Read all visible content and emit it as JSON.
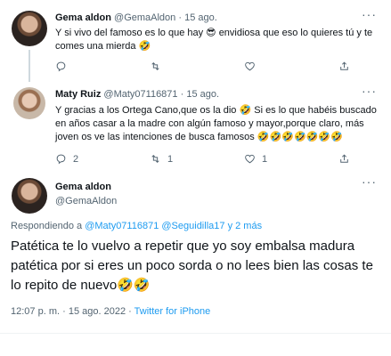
{
  "tweet1": {
    "name": "Gema aldon",
    "handle": "@GemaAldon",
    "sep": "·",
    "time": "15 ago.",
    "text_line1": "Y si vivo del famoso es lo que hay 😎 envidiosa que eso lo quieres tú y te",
    "text_line2": "comes una mierda 🤣",
    "reply_count": "",
    "retweet_count": "",
    "like_count": ""
  },
  "tweet2": {
    "name": "Maty Ruiz",
    "handle": "@Maty07116871",
    "sep": "·",
    "time": "15 ago.",
    "text_line1": "Y gracias a los Ortega Cano,que os la dio 🤣 Si es lo que habéis buscado",
    "text_line2": "en años casar a la madre con algún famoso y mayor,porque claro, más",
    "text_line3": "joven os ve las intenciones de busca famosos 🤣🤣🤣🤣🤣🤣🤣",
    "reply_count": "2",
    "retweet_count": "1",
    "like_count": "1"
  },
  "main_tweet": {
    "name": "Gema aldon",
    "handle": "@GemaAldon",
    "replying_prefix": "Respondiendo a",
    "replying_to_1": "@Maty07116871",
    "replying_to_2": "@Seguidilla17",
    "replying_suffix": "y 2 más",
    "text": "Patética te lo vuelvo a repetir que yo soy embalsa madura patética por si eres un poco sorda o no lees bien las cosas te lo repito de nuevo🤣🤣",
    "meta_time": "12:07 p. m.",
    "meta_date": "15 ago. 2022",
    "meta_source": "Twitter for iPhone",
    "meta_sep": "·"
  },
  "icons": {
    "reply": "reply-icon",
    "retweet": "retweet-icon",
    "like": "heart-icon",
    "share": "share-icon",
    "more": "more-icon"
  },
  "colors": {
    "link": "#1d9bf0",
    "muted": "#536471",
    "text": "#0f1419"
  }
}
